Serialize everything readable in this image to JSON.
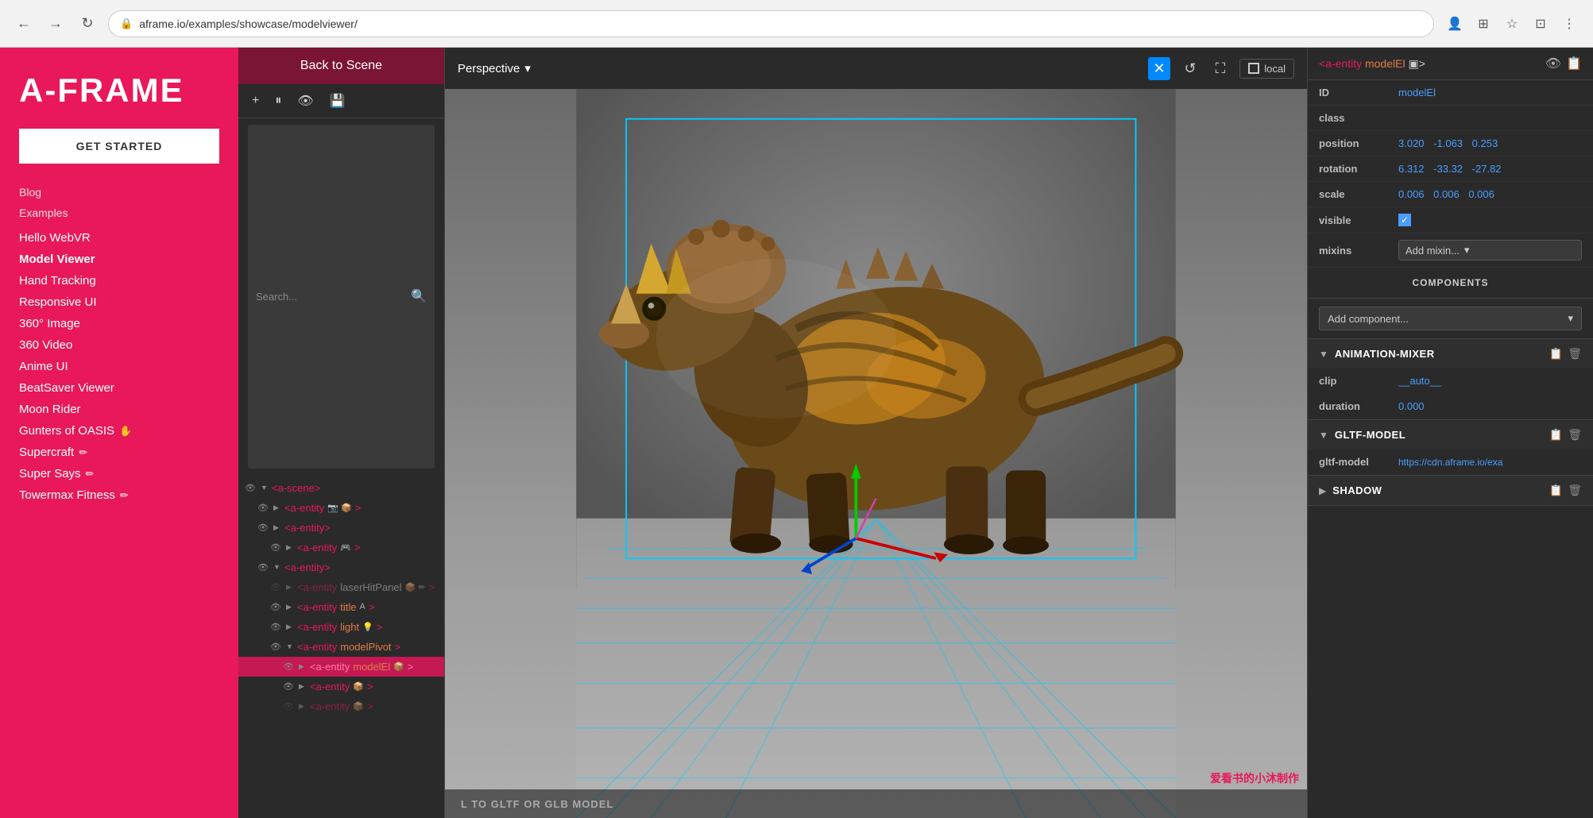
{
  "browser": {
    "back_label": "←",
    "forward_label": "→",
    "reload_label": "↺",
    "url": "aframe.io/examples/showcase/modelviewer/",
    "lock_icon": "🔒"
  },
  "sidebar": {
    "logo": "A-FRAME",
    "get_started": "GET STARTED",
    "blog_label": "Blog",
    "examples_label": "Examples",
    "links": [
      {
        "label": "Hello WebVR",
        "active": false,
        "icon": ""
      },
      {
        "label": "Model Viewer",
        "active": true,
        "icon": ""
      },
      {
        "label": "Hand Tracking",
        "active": false,
        "icon": ""
      },
      {
        "label": "Responsive UI",
        "active": false,
        "icon": ""
      },
      {
        "label": "360° Image",
        "active": false,
        "icon": ""
      },
      {
        "label": "360 Video",
        "active": false,
        "icon": ""
      },
      {
        "label": "Anime UI",
        "active": false,
        "icon": ""
      },
      {
        "label": "BeatSaver Viewer",
        "active": false,
        "icon": ""
      },
      {
        "label": "Moon Rider",
        "active": false,
        "icon": ""
      },
      {
        "label": "Gunters of OASIS",
        "active": false,
        "icon": "✋"
      },
      {
        "label": "Supercraft",
        "active": false,
        "icon": "✏️"
      },
      {
        "label": "Super Says",
        "active": false,
        "icon": "✏️"
      },
      {
        "label": "Towermax Fitness",
        "active": false,
        "icon": "✏️"
      }
    ]
  },
  "scene_panel": {
    "back_label": "Back to Scene",
    "search_placeholder": "Search...",
    "toolbar": {
      "add_label": "+",
      "pause_label": "⏸",
      "eye_label": "👁",
      "save_label": "💾"
    },
    "tree": [
      {
        "indent": 0,
        "visible": true,
        "expanded": true,
        "tag": "<a-scene>",
        "attr": "",
        "icons": ""
      },
      {
        "indent": 1,
        "visible": true,
        "expanded": false,
        "tag": "<a-entity",
        "attr": "",
        "icons": "📷 📦"
      },
      {
        "indent": 1,
        "visible": true,
        "expanded": true,
        "tag": "<a-entity>",
        "attr": "",
        "icons": ""
      },
      {
        "indent": 2,
        "visible": true,
        "expanded": false,
        "tag": "<a-entity",
        "attr": "",
        "icons": "🎮"
      },
      {
        "indent": 1,
        "visible": true,
        "expanded": true,
        "tag": "<a-entity>",
        "attr": "",
        "icons": ""
      },
      {
        "indent": 2,
        "visible": false,
        "expanded": false,
        "tag": "<a-entity laserHitPanel",
        "attr": "",
        "icons": "📦 ✏"
      },
      {
        "indent": 2,
        "visible": true,
        "expanded": false,
        "tag": "<a-entity",
        "attr": "title",
        "icons": "A"
      },
      {
        "indent": 2,
        "visible": true,
        "expanded": false,
        "tag": "<a-entity",
        "attr": "light",
        "icons": "💡"
      },
      {
        "indent": 2,
        "visible": true,
        "expanded": true,
        "tag": "<a-entity",
        "attr": "modelPivot",
        "icons": ""
      },
      {
        "indent": 3,
        "visible": true,
        "expanded": false,
        "tag": "<a-entity",
        "attr": "modelEl",
        "icons": "📦",
        "selected": true
      },
      {
        "indent": 3,
        "visible": true,
        "expanded": false,
        "tag": "<a-entity",
        "attr": "",
        "icons": "📦"
      },
      {
        "indent": 3,
        "visible": false,
        "expanded": false,
        "tag": "<a-entity",
        "attr": "",
        "icons": "📦",
        "dimmed": true
      }
    ]
  },
  "viewport": {
    "perspective_label": "Perspective",
    "chevron": "▾",
    "local_label": "local",
    "bottom_label": "L TO GLTF OR GLB MODEL"
  },
  "properties": {
    "header": {
      "tag_start": "<a-entity",
      "entity_id": "modelEl",
      "tag_end": "▣>"
    },
    "fields": {
      "id_label": "ID",
      "id_value": "modelEl",
      "class_label": "class",
      "class_value": "",
      "position_label": "position",
      "position_x": "3.020",
      "position_y": "-1.063",
      "position_z": "0.253",
      "rotation_label": "rotation",
      "rotation_x": "6.312",
      "rotation_y": "-33.32",
      "rotation_z": "-27.82",
      "scale_label": "scale",
      "scale_x": "0.006",
      "scale_y": "0.006",
      "scale_z": "0.006",
      "visible_label": "visible",
      "mixin_label": "mixins",
      "mixin_placeholder": "Add mixin..."
    },
    "components_label": "COMPONENTS",
    "add_component_placeholder": "Add component...",
    "animation_mixer": {
      "title": "ANIMATION-MIXER",
      "clip_label": "clip",
      "clip_value": "__auto__",
      "duration_label": "duration",
      "duration_value": "0.000"
    },
    "gltf_model": {
      "title": "GLTF-MODEL",
      "label": "gltf-model",
      "value": "https://cdn.aframe.io/exa"
    },
    "shadow": {
      "title": "SHADOW"
    }
  },
  "watermark": "爱看书的小沐制作"
}
